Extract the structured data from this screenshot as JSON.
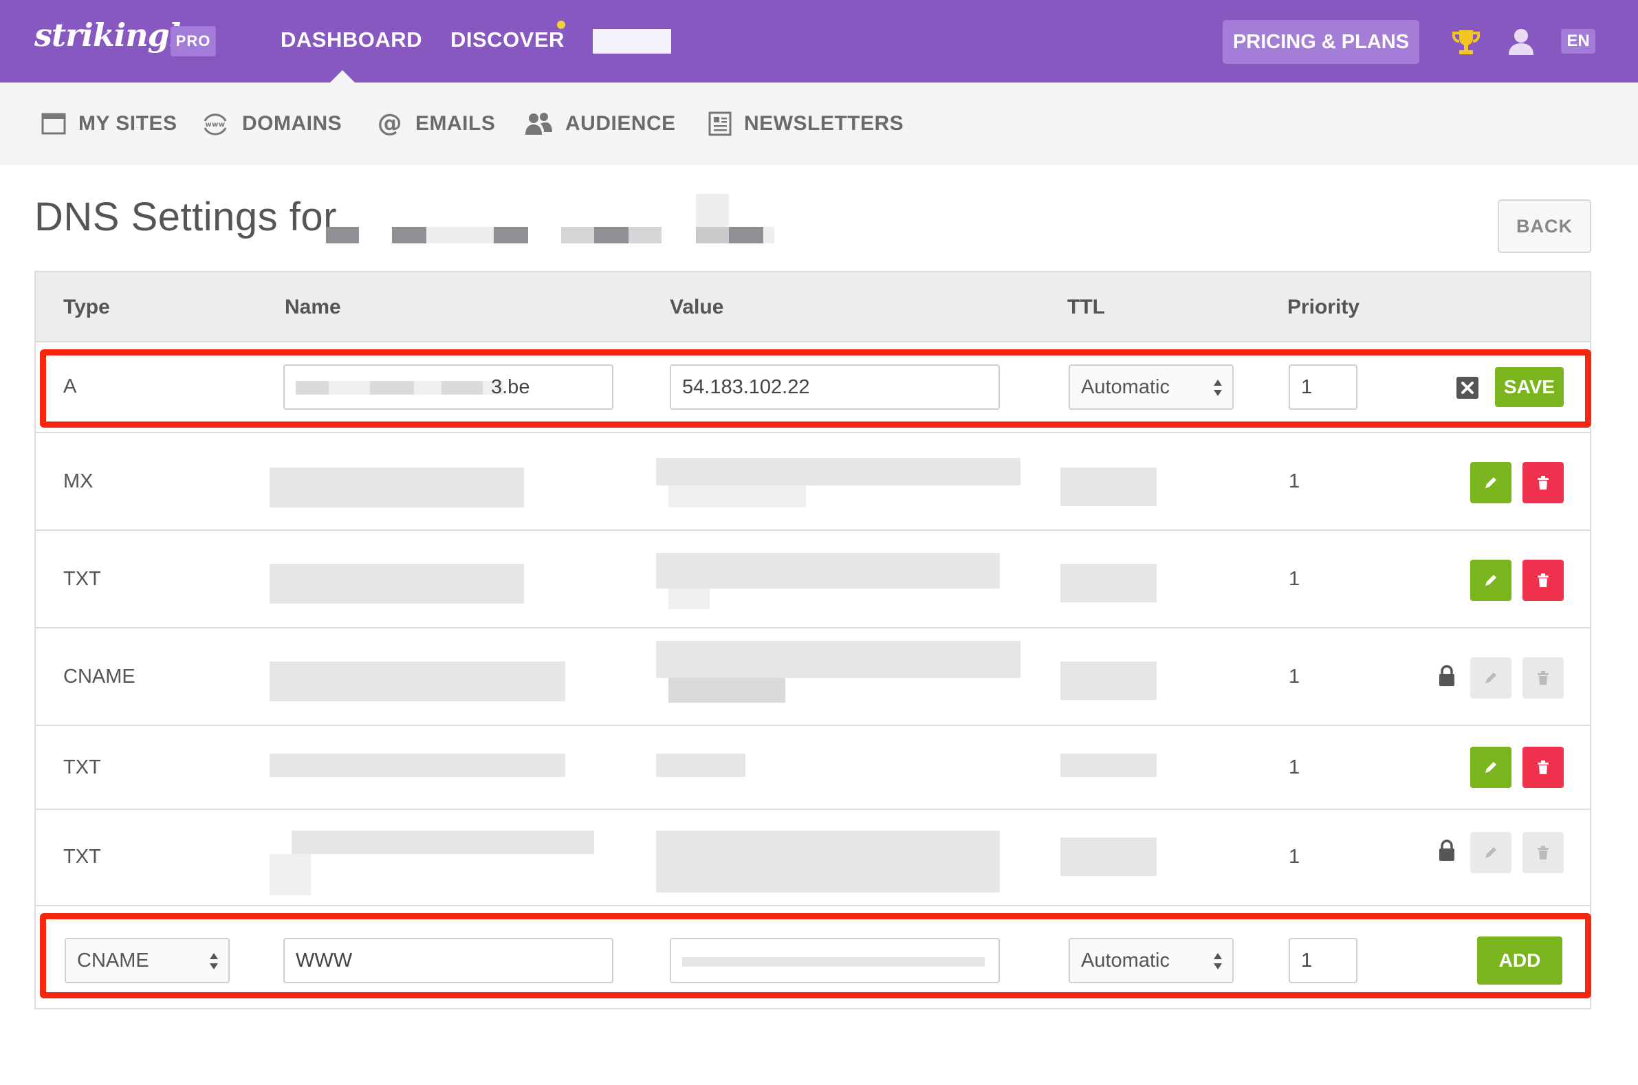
{
  "topnav": {
    "logo": "strikingly",
    "badge": "PRO",
    "links": [
      "DASHBOARD",
      "DISCOVER"
    ],
    "pricing": "PRICING & PLANS",
    "lang": "EN"
  },
  "subnav": {
    "items": [
      "MY SITES",
      "DOMAINS",
      "EMAILS",
      "AUDIENCE",
      "NEWSLETTERS"
    ]
  },
  "page": {
    "title": "DNS Settings for",
    "back": "BACK"
  },
  "table": {
    "headers": [
      "Type",
      "Name",
      "Value",
      "TTL",
      "Priority"
    ],
    "edit_row": {
      "type": "A",
      "name_suffix": "3.be",
      "value": "54.183.102.22",
      "ttl": "Automatic",
      "priority": "1",
      "save": "SAVE"
    },
    "rows": [
      {
        "type": "MX",
        "priority": "1"
      },
      {
        "type": "TXT",
        "priority": "1"
      },
      {
        "type": "CNAME",
        "priority": "1"
      },
      {
        "type": "TXT",
        "priority": "1"
      },
      {
        "type": "TXT",
        "priority": "1"
      }
    ],
    "add_row": {
      "type": "CNAME",
      "name": "WWW",
      "ttl": "Automatic",
      "priority": "1",
      "add": "ADD"
    }
  },
  "colors": {
    "brand_purple": "#8858c1",
    "accent_green": "#7ab51d",
    "danger_red": "#f0324f",
    "highlight_red": "#f5280f"
  },
  "icons": {
    "sub_my_sites": "browser-window-icon",
    "sub_domains": "www-globe-icon",
    "sub_emails": "at-sign-icon",
    "sub_audience": "users-icon",
    "sub_newsletters": "newsletter-icon"
  }
}
